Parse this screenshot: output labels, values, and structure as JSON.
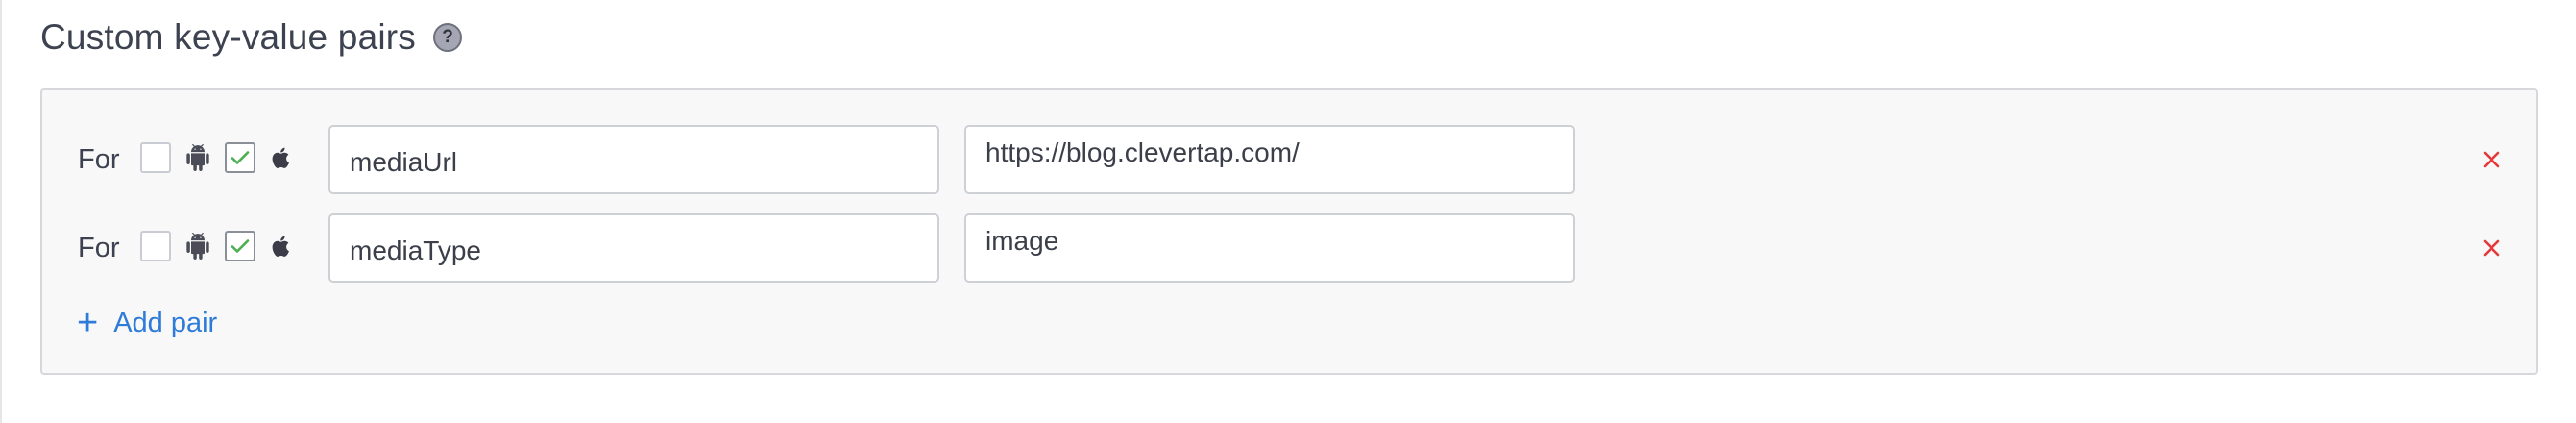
{
  "section": {
    "title": "Custom key-value pairs",
    "help_glyph": "?"
  },
  "pairs": [
    {
      "for_label": "For",
      "android_checked": false,
      "ios_checked": true,
      "key": "mediaUrl",
      "value": "https://blog.clevertap.com/"
    },
    {
      "for_label": "For",
      "android_checked": false,
      "ios_checked": true,
      "key": "mediaType",
      "value": "image"
    }
  ],
  "add_pair": {
    "icon": "+",
    "label": "Add pair"
  },
  "icons": {
    "android": "android-icon",
    "apple": "apple-icon",
    "check": "check-icon",
    "remove": "close-icon",
    "help": "help-icon"
  },
  "colors": {
    "accent": "#2f7bd8",
    "check": "#4caf50",
    "remove": "#e5393a",
    "panel_bg": "#f8f8f8",
    "title": "#3d4250"
  }
}
